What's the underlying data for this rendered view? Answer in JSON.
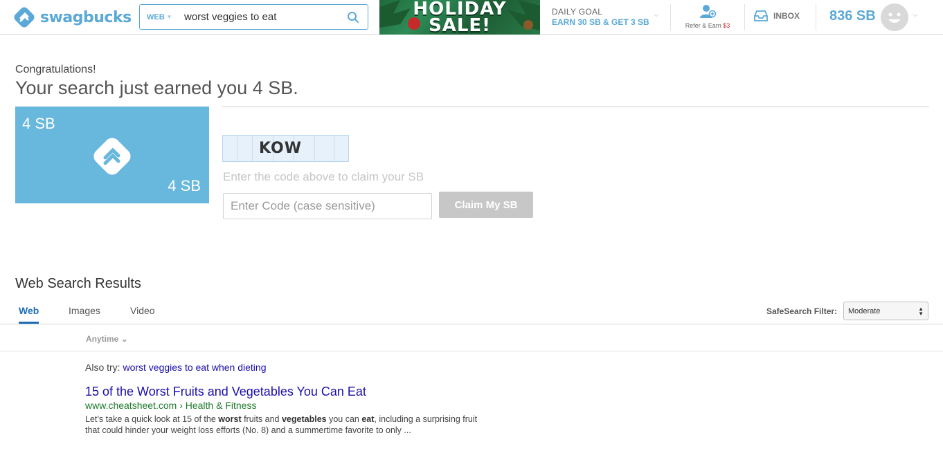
{
  "header": {
    "logo_text": "swagbucks",
    "search": {
      "scope": "WEB",
      "value": "worst veggies to eat"
    },
    "banner": {
      "line1": "HOLIDAY",
      "line2": "SALE!"
    },
    "daily_goal": {
      "title": "DAILY GOAL",
      "subtitle": "EARN 30 SB & GET 3 SB"
    },
    "refer": {
      "label": "Refer & Earn",
      "amount": "$3"
    },
    "inbox_label": "INBOX",
    "balance": "836 SB"
  },
  "congrats": {
    "small": "Congratulations!",
    "big": "Your search just earned you 4 SB."
  },
  "card": {
    "top_left": "4 SB",
    "bottom_right": "4 SB"
  },
  "captcha": {
    "code": "KOW",
    "hint": "Enter the code above to claim your SB",
    "input_placeholder": "Enter Code (case sensitive)",
    "button_label": "Claim My SB"
  },
  "results": {
    "title": "Web Search Results",
    "tabs": [
      {
        "label": "Web",
        "active": true
      },
      {
        "label": "Images",
        "active": false
      },
      {
        "label": "Video",
        "active": false
      }
    ],
    "safesearch_label": "SafeSearch Filter:",
    "safesearch_value": "Moderate",
    "anytime": "Anytime",
    "also_try_label": "Also try:",
    "also_try_link": "worst veggies to eat when dieting",
    "items": [
      {
        "title": "15 of the Worst Fruits and Vegetables You Can Eat",
        "url": "www.cheatsheet.com",
        "breadcrumb": "› Health & Fitness",
        "snippet_1": "Let’s take a quick look at 15 of the ",
        "snippet_b1": "worst",
        "snippet_2": " fruits and ",
        "snippet_b2": "vegetables",
        "snippet_3": " you can ",
        "snippet_b3": "eat",
        "snippet_4": ", including a surprising fruit that could hinder your weight loss efforts (No. 8) and a summertime favorite to only ..."
      }
    ]
  },
  "colors": {
    "brand": "#5aa9d6",
    "card": "#68b7dc",
    "link": "#1a0dab",
    "url": "#1d7a2a"
  }
}
